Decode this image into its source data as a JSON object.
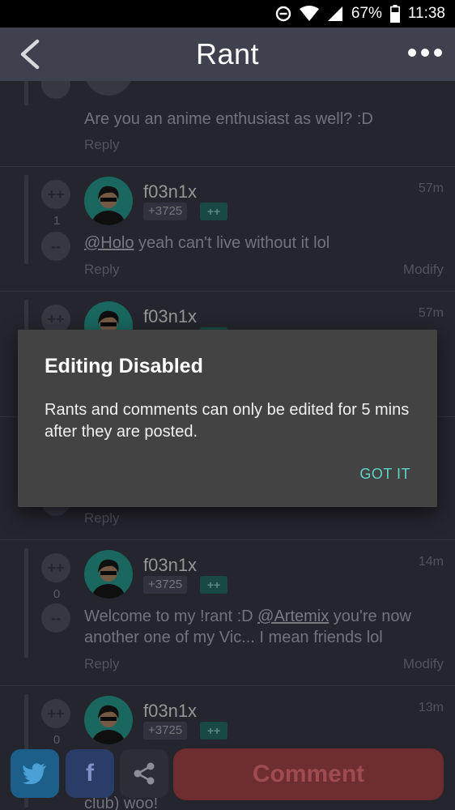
{
  "status_bar": {
    "battery": "67%",
    "time": "11:38"
  },
  "app_bar": {
    "title": "Rant"
  },
  "comments": [
    {
      "body_plain": "Are you an anime enthusiast as well? :D",
      "reply": "Reply"
    },
    {
      "username": "f03n1x",
      "rep": "+3725",
      "plus": "++",
      "time": "57m",
      "score": "1",
      "mention": "@Holo",
      "body_rest": " yeah can't live without it lol",
      "reply": "Reply",
      "modify": "Modify"
    },
    {
      "username": "f03n1x",
      "time": "57m"
    },
    {
      "reply": "Reply"
    },
    {
      "username": "f03n1x",
      "rep": "+3725",
      "plus": "++",
      "time": "14m",
      "score": "0",
      "body_a": "Welcome to my !rant :D ",
      "mention": "@Artemix",
      "body_b": " you're now another one of my Vic... I mean friends lol",
      "reply": "Reply",
      "modify": "Modify"
    },
    {
      "username": "f03n1x",
      "rep": "+3725",
      "plus": "++",
      "time": "13m",
      "score": "0",
      "body_tail": "club) woo!"
    }
  ],
  "vote": {
    "up": "++",
    "down": "--"
  },
  "dialog": {
    "title": "Editing Disabled",
    "message": "Rants and comments can only be edited for 5 mins after they are posted.",
    "button": "GOT IT"
  },
  "bottom_bar": {
    "comment_label": "Comment",
    "facebook_glyph": "f"
  },
  "colors": {
    "background": "#40414f",
    "accent": "#5ed3c6",
    "comment_button": "#d55161"
  }
}
